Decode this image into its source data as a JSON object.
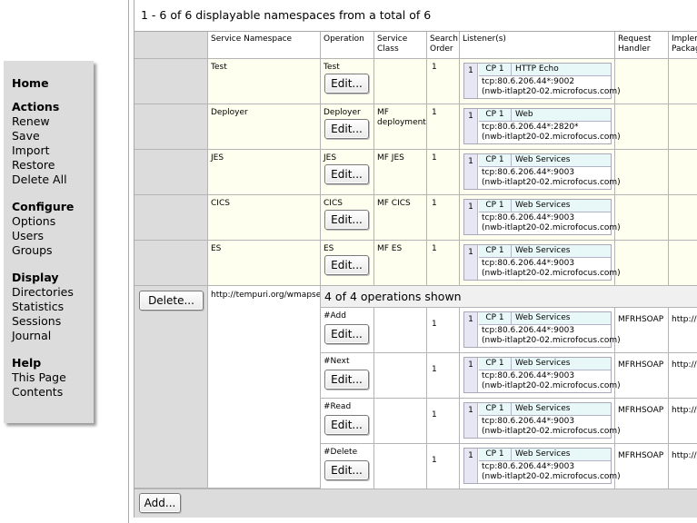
{
  "menu": {
    "home": "Home",
    "groups": [
      {
        "heading": "Actions",
        "items": [
          "Renew",
          "Save",
          "Import",
          "Restore",
          "Delete All"
        ]
      },
      {
        "heading": "Configure",
        "items": [
          "Options",
          "Users",
          "Groups"
        ]
      },
      {
        "heading": "Display",
        "items": [
          "Directories",
          "Statistics",
          "Sessions",
          "Journal"
        ]
      },
      {
        "heading": "Help",
        "items": [
          "This Page",
          "Contents"
        ]
      }
    ]
  },
  "summary": "1 - 6 of 6 displayable namespaces from a total of 6",
  "table": {
    "headers": {
      "namespace": "Service Namespace",
      "operation": "Operation",
      "class": "Service Class",
      "search_order": "Search Order",
      "listeners": "Listener(s)",
      "handler": "Request Handler",
      "package": "Implem Packag"
    },
    "edit_label": "Edit...",
    "delete_label": "Delete...",
    "add_label": "Add...",
    "rows": [
      {
        "namespace": "Test",
        "operation": "Test",
        "class": "",
        "order": "1",
        "listener": {
          "num": "1",
          "cp": "CP 1",
          "type": "HTTP Echo",
          "addr": "tcp:80.6.206.44*:9002",
          "host": "(nwb-itlapt20-02.microfocus.com)"
        }
      },
      {
        "namespace": "Deployer",
        "operation": "Deployer",
        "class": "MF deployment",
        "order": "1",
        "listener": {
          "num": "1",
          "cp": "CP 1",
          "type": "Web",
          "addr": "tcp:80.6.206.44*:2820*",
          "host": "(nwb-itlapt20-02.microfocus.com)"
        }
      },
      {
        "namespace": "JES",
        "operation": "JES",
        "class": "MF JES",
        "order": "1",
        "listener": {
          "num": "1",
          "cp": "CP 1",
          "type": "Web Services",
          "addr": "tcp:80.6.206.44*:9003",
          "host": "(nwb-itlapt20-02.microfocus.com)"
        }
      },
      {
        "namespace": "CICS",
        "operation": "CICS",
        "class": "MF CICS",
        "order": "1",
        "listener": {
          "num": "1",
          "cp": "CP 1",
          "type": "Web Services",
          "addr": "tcp:80.6.206.44*:9003",
          "host": "(nwb-itlapt20-02.microfocus.com)"
        }
      },
      {
        "namespace": "ES",
        "operation": "ES",
        "class": "MF ES",
        "order": "1",
        "listener": {
          "num": "1",
          "cp": "CP 1",
          "type": "Web Services",
          "addr": "tcp:80.6.206.44*:9003",
          "host": "(nwb-itlapt20-02.microfocus.com)"
        }
      }
    ],
    "group": {
      "namespace": "http://tempuri.org/wmapserv",
      "ops_shown": "4 of 4 operations shown",
      "ops": [
        {
          "operation": "#Add",
          "order": "1",
          "handler": "MFRHSOAP",
          "package": "http://t",
          "listener": {
            "num": "1",
            "cp": "CP 1",
            "type": "Web Services",
            "addr": "tcp:80.6.206.44*:9003",
            "host": "(nwb-itlapt20-02.microfocus.com)"
          }
        },
        {
          "operation": "#Next",
          "order": "1",
          "handler": "MFRHSOAP",
          "package": "http://t",
          "listener": {
            "num": "1",
            "cp": "CP 1",
            "type": "Web Services",
            "addr": "tcp:80.6.206.44*:9003",
            "host": "(nwb-itlapt20-02.microfocus.com)"
          }
        },
        {
          "operation": "#Read",
          "order": "1",
          "handler": "MFRHSOAP",
          "package": "http://t",
          "listener": {
            "num": "1",
            "cp": "CP 1",
            "type": "Web Services",
            "addr": "tcp:80.6.206.44*:9003",
            "host": "(nwb-itlapt20-02.microfocus.com)"
          }
        },
        {
          "operation": "#Delete",
          "order": "1",
          "handler": "MFRHSOAP",
          "package": "http://t",
          "listener": {
            "num": "1",
            "cp": "CP 1",
            "type": "Web Services",
            "addr": "tcp:80.6.206.44*:9003",
            "host": "(nwb-itlapt20-02.microfocus.com)"
          }
        }
      ]
    }
  }
}
